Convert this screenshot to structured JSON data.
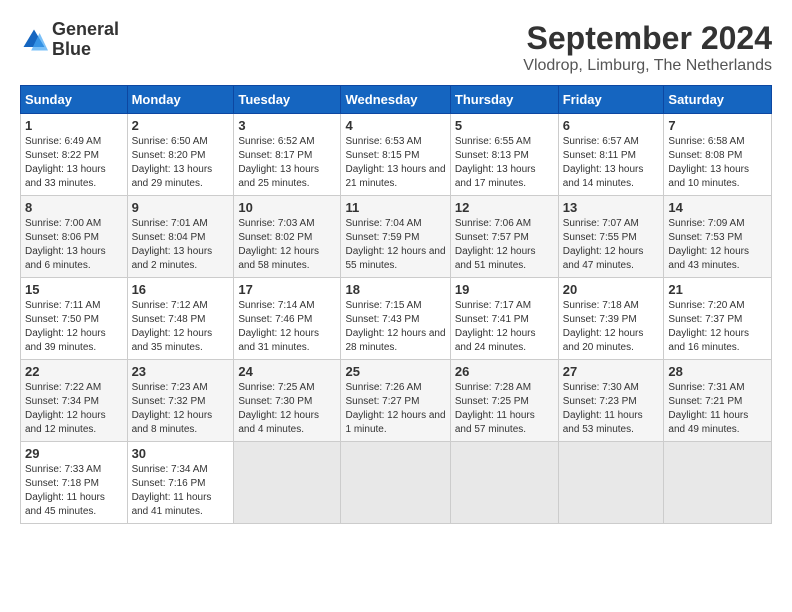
{
  "header": {
    "logo_line1": "General",
    "logo_line2": "Blue",
    "title": "September 2024",
    "subtitle": "Vlodrop, Limburg, The Netherlands"
  },
  "days_of_week": [
    "Sunday",
    "Monday",
    "Tuesday",
    "Wednesday",
    "Thursday",
    "Friday",
    "Saturday"
  ],
  "weeks": [
    [
      {
        "day": "1",
        "sunrise": "Sunrise: 6:49 AM",
        "sunset": "Sunset: 8:22 PM",
        "daylight": "Daylight: 13 hours and 33 minutes."
      },
      {
        "day": "2",
        "sunrise": "Sunrise: 6:50 AM",
        "sunset": "Sunset: 8:20 PM",
        "daylight": "Daylight: 13 hours and 29 minutes."
      },
      {
        "day": "3",
        "sunrise": "Sunrise: 6:52 AM",
        "sunset": "Sunset: 8:17 PM",
        "daylight": "Daylight: 13 hours and 25 minutes."
      },
      {
        "day": "4",
        "sunrise": "Sunrise: 6:53 AM",
        "sunset": "Sunset: 8:15 PM",
        "daylight": "Daylight: 13 hours and 21 minutes."
      },
      {
        "day": "5",
        "sunrise": "Sunrise: 6:55 AM",
        "sunset": "Sunset: 8:13 PM",
        "daylight": "Daylight: 13 hours and 17 minutes."
      },
      {
        "day": "6",
        "sunrise": "Sunrise: 6:57 AM",
        "sunset": "Sunset: 8:11 PM",
        "daylight": "Daylight: 13 hours and 14 minutes."
      },
      {
        "day": "7",
        "sunrise": "Sunrise: 6:58 AM",
        "sunset": "Sunset: 8:08 PM",
        "daylight": "Daylight: 13 hours and 10 minutes."
      }
    ],
    [
      {
        "day": "8",
        "sunrise": "Sunrise: 7:00 AM",
        "sunset": "Sunset: 8:06 PM",
        "daylight": "Daylight: 13 hours and 6 minutes."
      },
      {
        "day": "9",
        "sunrise": "Sunrise: 7:01 AM",
        "sunset": "Sunset: 8:04 PM",
        "daylight": "Daylight: 13 hours and 2 minutes."
      },
      {
        "day": "10",
        "sunrise": "Sunrise: 7:03 AM",
        "sunset": "Sunset: 8:02 PM",
        "daylight": "Daylight: 12 hours and 58 minutes."
      },
      {
        "day": "11",
        "sunrise": "Sunrise: 7:04 AM",
        "sunset": "Sunset: 7:59 PM",
        "daylight": "Daylight: 12 hours and 55 minutes."
      },
      {
        "day": "12",
        "sunrise": "Sunrise: 7:06 AM",
        "sunset": "Sunset: 7:57 PM",
        "daylight": "Daylight: 12 hours and 51 minutes."
      },
      {
        "day": "13",
        "sunrise": "Sunrise: 7:07 AM",
        "sunset": "Sunset: 7:55 PM",
        "daylight": "Daylight: 12 hours and 47 minutes."
      },
      {
        "day": "14",
        "sunrise": "Sunrise: 7:09 AM",
        "sunset": "Sunset: 7:53 PM",
        "daylight": "Daylight: 12 hours and 43 minutes."
      }
    ],
    [
      {
        "day": "15",
        "sunrise": "Sunrise: 7:11 AM",
        "sunset": "Sunset: 7:50 PM",
        "daylight": "Daylight: 12 hours and 39 minutes."
      },
      {
        "day": "16",
        "sunrise": "Sunrise: 7:12 AM",
        "sunset": "Sunset: 7:48 PM",
        "daylight": "Daylight: 12 hours and 35 minutes."
      },
      {
        "day": "17",
        "sunrise": "Sunrise: 7:14 AM",
        "sunset": "Sunset: 7:46 PM",
        "daylight": "Daylight: 12 hours and 31 minutes."
      },
      {
        "day": "18",
        "sunrise": "Sunrise: 7:15 AM",
        "sunset": "Sunset: 7:43 PM",
        "daylight": "Daylight: 12 hours and 28 minutes."
      },
      {
        "day": "19",
        "sunrise": "Sunrise: 7:17 AM",
        "sunset": "Sunset: 7:41 PM",
        "daylight": "Daylight: 12 hours and 24 minutes."
      },
      {
        "day": "20",
        "sunrise": "Sunrise: 7:18 AM",
        "sunset": "Sunset: 7:39 PM",
        "daylight": "Daylight: 12 hours and 20 minutes."
      },
      {
        "day": "21",
        "sunrise": "Sunrise: 7:20 AM",
        "sunset": "Sunset: 7:37 PM",
        "daylight": "Daylight: 12 hours and 16 minutes."
      }
    ],
    [
      {
        "day": "22",
        "sunrise": "Sunrise: 7:22 AM",
        "sunset": "Sunset: 7:34 PM",
        "daylight": "Daylight: 12 hours and 12 minutes."
      },
      {
        "day": "23",
        "sunrise": "Sunrise: 7:23 AM",
        "sunset": "Sunset: 7:32 PM",
        "daylight": "Daylight: 12 hours and 8 minutes."
      },
      {
        "day": "24",
        "sunrise": "Sunrise: 7:25 AM",
        "sunset": "Sunset: 7:30 PM",
        "daylight": "Daylight: 12 hours and 4 minutes."
      },
      {
        "day": "25",
        "sunrise": "Sunrise: 7:26 AM",
        "sunset": "Sunset: 7:27 PM",
        "daylight": "Daylight: 12 hours and 1 minute."
      },
      {
        "day": "26",
        "sunrise": "Sunrise: 7:28 AM",
        "sunset": "Sunset: 7:25 PM",
        "daylight": "Daylight: 11 hours and 57 minutes."
      },
      {
        "day": "27",
        "sunrise": "Sunrise: 7:30 AM",
        "sunset": "Sunset: 7:23 PM",
        "daylight": "Daylight: 11 hours and 53 minutes."
      },
      {
        "day": "28",
        "sunrise": "Sunrise: 7:31 AM",
        "sunset": "Sunset: 7:21 PM",
        "daylight": "Daylight: 11 hours and 49 minutes."
      }
    ],
    [
      {
        "day": "29",
        "sunrise": "Sunrise: 7:33 AM",
        "sunset": "Sunset: 7:18 PM",
        "daylight": "Daylight: 11 hours and 45 minutes."
      },
      {
        "day": "30",
        "sunrise": "Sunrise: 7:34 AM",
        "sunset": "Sunset: 7:16 PM",
        "daylight": "Daylight: 11 hours and 41 minutes."
      },
      null,
      null,
      null,
      null,
      null
    ]
  ]
}
